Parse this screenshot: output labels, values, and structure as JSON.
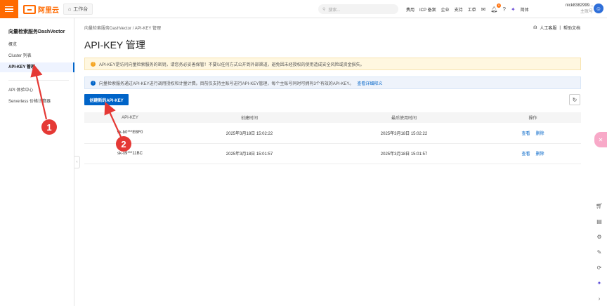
{
  "topbar": {
    "logo_text": "阿里云",
    "workbench": "工作台",
    "search_placeholder": "搜索...",
    "links": [
      "费用",
      "ICP 备案",
      "企业",
      "支持",
      "工单"
    ],
    "notification_count": "11",
    "language": "简体",
    "username": "nick8382999...",
    "account_type": "主账号",
    "accent_color": "#ff6a00"
  },
  "sidebar": {
    "title": "向量检索服务DashVector",
    "items": [
      {
        "label": "概览"
      },
      {
        "label": "Cluster 列表"
      },
      {
        "label": "API-KEY 管理"
      },
      {
        "label": "API 体验中心"
      },
      {
        "label": "Serverless 价格计算器"
      }
    ],
    "active_index": 2
  },
  "main": {
    "breadcrumb": [
      "向量检索服务DashVector",
      "API-KEY 管理"
    ],
    "help": [
      "人工客服",
      "帮助文档"
    ],
    "title": "API-KEY 管理",
    "warning_text": "API-KEY是访问向量检索服务的密钥，请您务必妥善保管！不要以任何方式公开到外部渠道，避免因未经授权的使用造成安全风险或资金损失。",
    "info_text": "向量检索服务通过API-KEY进行调用授权和计量计费。目前仅支持主账号进行API-KEY管理，每个主账号同时可拥有3个有效的API-KEY。",
    "info_link": "查看详细释义",
    "create_button": "创建新的API-KEY",
    "table": {
      "headers": [
        "API-KEY",
        "创建时间",
        "最后使用时间",
        "操作"
      ],
      "rows": [
        {
          "key": "sk-b0***EBF0",
          "created": "2025年3月18日 15:02:22",
          "last_used": "2025年3月18日 15:02:22"
        },
        {
          "key": "sk-x9***11BC",
          "created": "2025年3月18日 15:01:57",
          "last_used": "2025年3月18日 15:01:57"
        }
      ],
      "actions": [
        "查看",
        "删除"
      ]
    }
  },
  "annotations": {
    "marker_1": "1",
    "marker_2": "2",
    "color": "#e53935"
  }
}
